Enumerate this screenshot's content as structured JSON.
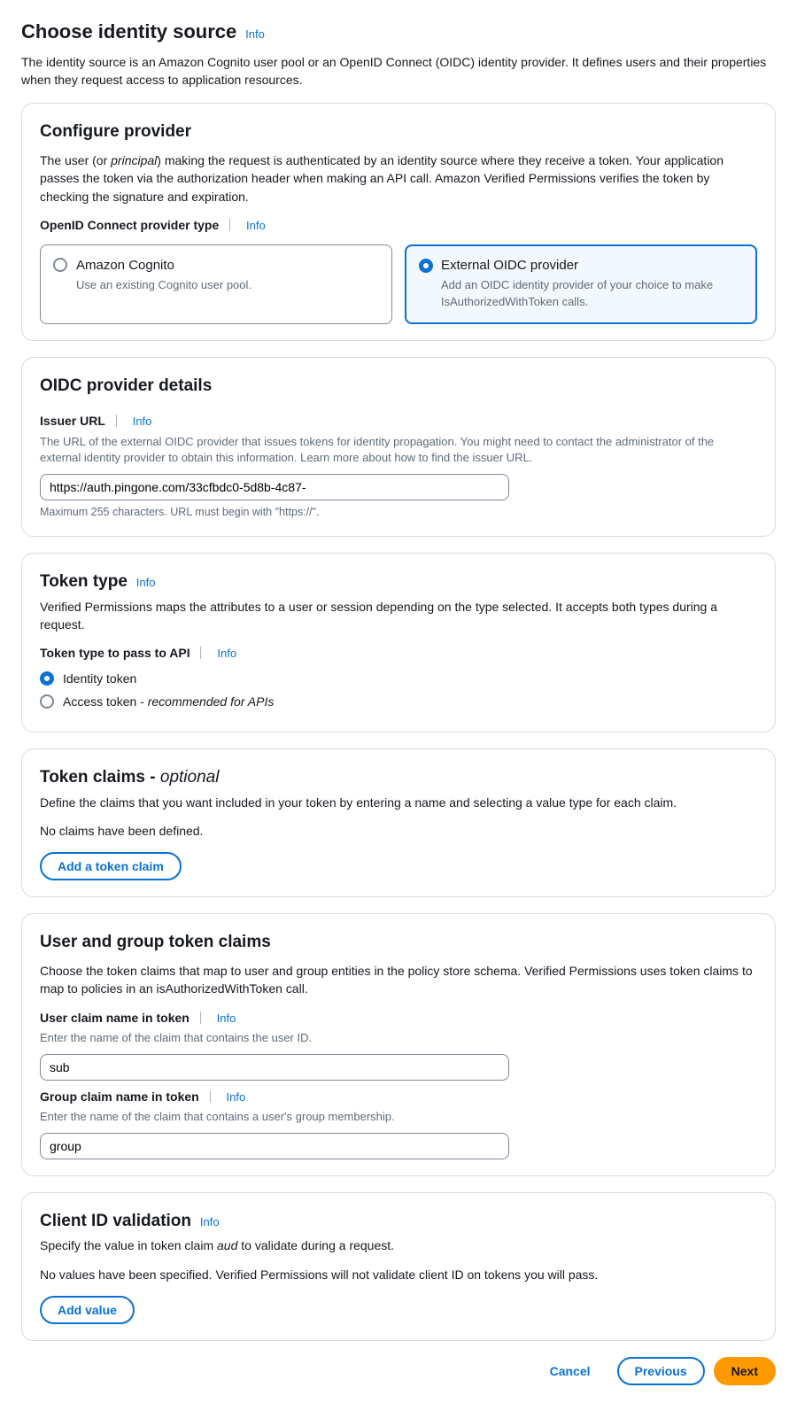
{
  "info_label": "Info",
  "page": {
    "title": "Choose identity source",
    "desc": "The identity source is an Amazon Cognito user pool or an OpenID Connect (OIDC) identity provider. It defines users and their properties when they request access to application resources."
  },
  "configure_provider": {
    "title": "Configure provider",
    "desc_pre": "The user (or ",
    "desc_em": "principal",
    "desc_post": ") making the request is authenticated by an identity source where they receive a token. Your application passes the token via the authorization header when making an API call. Amazon Verified Permissions verifies the token by checking the signature and expiration.",
    "type_label": "OpenID Connect provider type",
    "option_cognito": {
      "title": "Amazon Cognito",
      "sub": "Use an existing Cognito user pool."
    },
    "option_external": {
      "title": "External OIDC provider",
      "sub": "Add an OIDC identity provider of your choice to make IsAuthorizedWithToken calls."
    }
  },
  "oidc_details": {
    "title": "OIDC provider details",
    "issuer_label": "Issuer URL",
    "issuer_desc": "The URL of the external OIDC provider that issues tokens for identity propagation. You might need to contact the administrator of the external identity provider to obtain this information. Learn more about how to find the issuer URL.",
    "issuer_value": "https://auth.pingone.com/33cfbdc0-5d8b-4c87-",
    "issuer_hint": "Maximum 255 characters. URL must begin with \"https://\"."
  },
  "token_type": {
    "title": "Token type",
    "desc": "Verified Permissions maps the attributes to a user or session depending on the type selected. It accepts both types during a request.",
    "field_label": "Token type to pass to API",
    "identity_label": "Identity token",
    "access_label_pre": "Access token - ",
    "access_label_em": "recommended for APIs"
  },
  "token_claims": {
    "title_main": "Token claims",
    "title_dash": " - ",
    "title_suffix": "optional",
    "desc": "Define the claims that you want included in your token by entering a name and selecting a value type for each claim.",
    "empty": "No claims have been defined.",
    "add_button": "Add a token claim"
  },
  "user_group_claims": {
    "title": "User and group token claims",
    "desc": "Choose the token claims that map to user and group entities in the policy store schema. Verified Permissions uses token claims to map to policies in an isAuthorizedWithToken call.",
    "user_label": "User claim name in token",
    "user_hint": "Enter the name of the claim that contains the user ID.",
    "user_value": "sub",
    "group_label": "Group claim name in token",
    "group_hint": "Enter the name of the claim that contains a user's group membership.",
    "group_value": "group"
  },
  "client_id": {
    "title": "Client ID validation",
    "desc_pre": "Specify the value in token claim ",
    "desc_em": "aud",
    "desc_post": " to validate during a request.",
    "empty": "No values have been specified. Verified Permissions will not validate client ID on tokens you will pass.",
    "add_button": "Add value"
  },
  "footer": {
    "cancel": "Cancel",
    "previous": "Previous",
    "next": "Next"
  }
}
